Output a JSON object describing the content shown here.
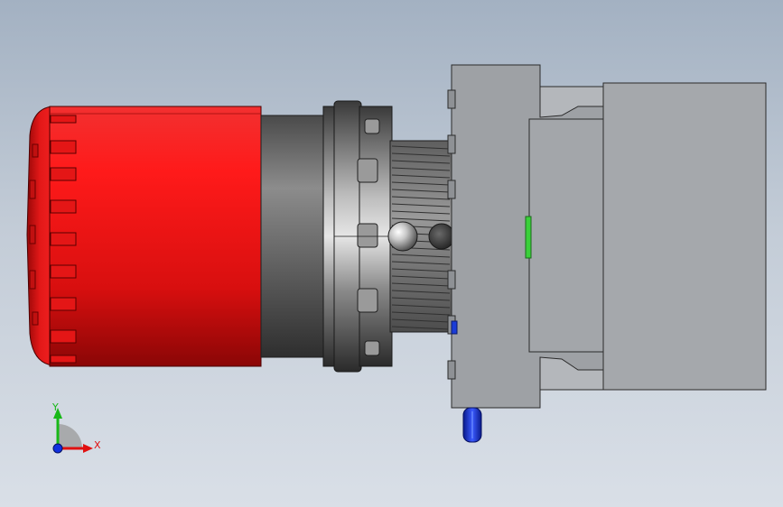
{
  "viewport": {
    "background_top": "#a3b1c2",
    "background_bottom": "#d9dfe7"
  },
  "model": {
    "parts": [
      {
        "name": "mushroom-cap",
        "color": "#e01414"
      },
      {
        "name": "cap-stem",
        "color": "#6e6e6e"
      },
      {
        "name": "locking-ring",
        "color": "#5a5a5a"
      },
      {
        "name": "threaded-collar",
        "color": "#7a7a7a"
      },
      {
        "name": "contact-block-housing",
        "color": "#9ea1a5"
      },
      {
        "name": "contact-block-module",
        "color": "#a5a8ac"
      },
      {
        "name": "indicator-green",
        "color": "#3ad03a"
      },
      {
        "name": "terminal-blue",
        "color": "#1a3cd8"
      }
    ]
  },
  "triad": {
    "x_label": "X",
    "y_label": "Y",
    "x_color": "#e01010",
    "y_color": "#18b818",
    "z_color": "#1030e0"
  }
}
